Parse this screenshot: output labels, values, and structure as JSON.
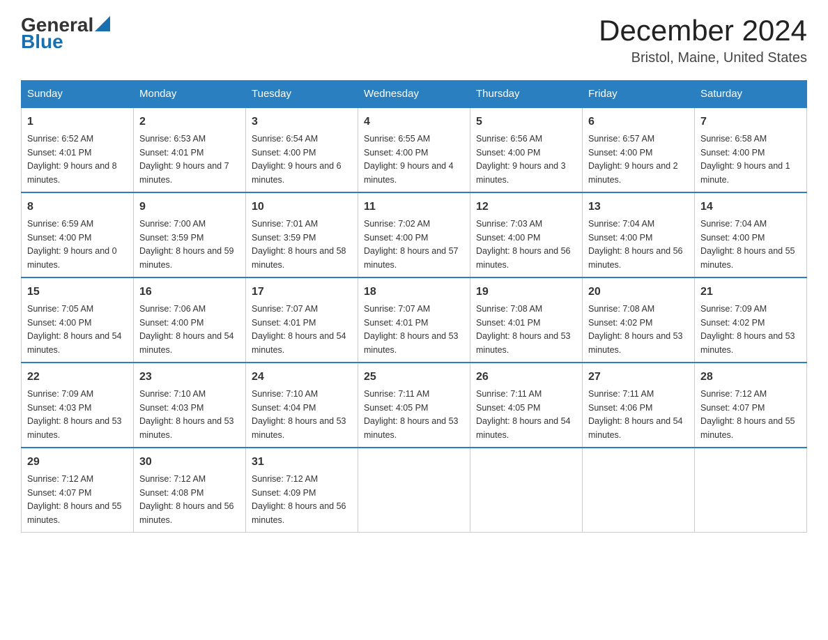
{
  "logo": {
    "general": "General",
    "blue": "Blue"
  },
  "title": "December 2024",
  "subtitle": "Bristol, Maine, United States",
  "days_of_week": [
    "Sunday",
    "Monday",
    "Tuesday",
    "Wednesday",
    "Thursday",
    "Friday",
    "Saturday"
  ],
  "weeks": [
    [
      {
        "day": "1",
        "sunrise": "6:52 AM",
        "sunset": "4:01 PM",
        "daylight": "9 hours and 8 minutes."
      },
      {
        "day": "2",
        "sunrise": "6:53 AM",
        "sunset": "4:01 PM",
        "daylight": "9 hours and 7 minutes."
      },
      {
        "day": "3",
        "sunrise": "6:54 AM",
        "sunset": "4:00 PM",
        "daylight": "9 hours and 6 minutes."
      },
      {
        "day": "4",
        "sunrise": "6:55 AM",
        "sunset": "4:00 PM",
        "daylight": "9 hours and 4 minutes."
      },
      {
        "day": "5",
        "sunrise": "6:56 AM",
        "sunset": "4:00 PM",
        "daylight": "9 hours and 3 minutes."
      },
      {
        "day": "6",
        "sunrise": "6:57 AM",
        "sunset": "4:00 PM",
        "daylight": "9 hours and 2 minutes."
      },
      {
        "day": "7",
        "sunrise": "6:58 AM",
        "sunset": "4:00 PM",
        "daylight": "9 hours and 1 minute."
      }
    ],
    [
      {
        "day": "8",
        "sunrise": "6:59 AM",
        "sunset": "4:00 PM",
        "daylight": "9 hours and 0 minutes."
      },
      {
        "day": "9",
        "sunrise": "7:00 AM",
        "sunset": "3:59 PM",
        "daylight": "8 hours and 59 minutes."
      },
      {
        "day": "10",
        "sunrise": "7:01 AM",
        "sunset": "3:59 PM",
        "daylight": "8 hours and 58 minutes."
      },
      {
        "day": "11",
        "sunrise": "7:02 AM",
        "sunset": "4:00 PM",
        "daylight": "8 hours and 57 minutes."
      },
      {
        "day": "12",
        "sunrise": "7:03 AM",
        "sunset": "4:00 PM",
        "daylight": "8 hours and 56 minutes."
      },
      {
        "day": "13",
        "sunrise": "7:04 AM",
        "sunset": "4:00 PM",
        "daylight": "8 hours and 56 minutes."
      },
      {
        "day": "14",
        "sunrise": "7:04 AM",
        "sunset": "4:00 PM",
        "daylight": "8 hours and 55 minutes."
      }
    ],
    [
      {
        "day": "15",
        "sunrise": "7:05 AM",
        "sunset": "4:00 PM",
        "daylight": "8 hours and 54 minutes."
      },
      {
        "day": "16",
        "sunrise": "7:06 AM",
        "sunset": "4:00 PM",
        "daylight": "8 hours and 54 minutes."
      },
      {
        "day": "17",
        "sunrise": "7:07 AM",
        "sunset": "4:01 PM",
        "daylight": "8 hours and 54 minutes."
      },
      {
        "day": "18",
        "sunrise": "7:07 AM",
        "sunset": "4:01 PM",
        "daylight": "8 hours and 53 minutes."
      },
      {
        "day": "19",
        "sunrise": "7:08 AM",
        "sunset": "4:01 PM",
        "daylight": "8 hours and 53 minutes."
      },
      {
        "day": "20",
        "sunrise": "7:08 AM",
        "sunset": "4:02 PM",
        "daylight": "8 hours and 53 minutes."
      },
      {
        "day": "21",
        "sunrise": "7:09 AM",
        "sunset": "4:02 PM",
        "daylight": "8 hours and 53 minutes."
      }
    ],
    [
      {
        "day": "22",
        "sunrise": "7:09 AM",
        "sunset": "4:03 PM",
        "daylight": "8 hours and 53 minutes."
      },
      {
        "day": "23",
        "sunrise": "7:10 AM",
        "sunset": "4:03 PM",
        "daylight": "8 hours and 53 minutes."
      },
      {
        "day": "24",
        "sunrise": "7:10 AM",
        "sunset": "4:04 PM",
        "daylight": "8 hours and 53 minutes."
      },
      {
        "day": "25",
        "sunrise": "7:11 AM",
        "sunset": "4:05 PM",
        "daylight": "8 hours and 53 minutes."
      },
      {
        "day": "26",
        "sunrise": "7:11 AM",
        "sunset": "4:05 PM",
        "daylight": "8 hours and 54 minutes."
      },
      {
        "day": "27",
        "sunrise": "7:11 AM",
        "sunset": "4:06 PM",
        "daylight": "8 hours and 54 minutes."
      },
      {
        "day": "28",
        "sunrise": "7:12 AM",
        "sunset": "4:07 PM",
        "daylight": "8 hours and 55 minutes."
      }
    ],
    [
      {
        "day": "29",
        "sunrise": "7:12 AM",
        "sunset": "4:07 PM",
        "daylight": "8 hours and 55 minutes."
      },
      {
        "day": "30",
        "sunrise": "7:12 AM",
        "sunset": "4:08 PM",
        "daylight": "8 hours and 56 minutes."
      },
      {
        "day": "31",
        "sunrise": "7:12 AM",
        "sunset": "4:09 PM",
        "daylight": "8 hours and 56 minutes."
      },
      null,
      null,
      null,
      null
    ]
  ]
}
